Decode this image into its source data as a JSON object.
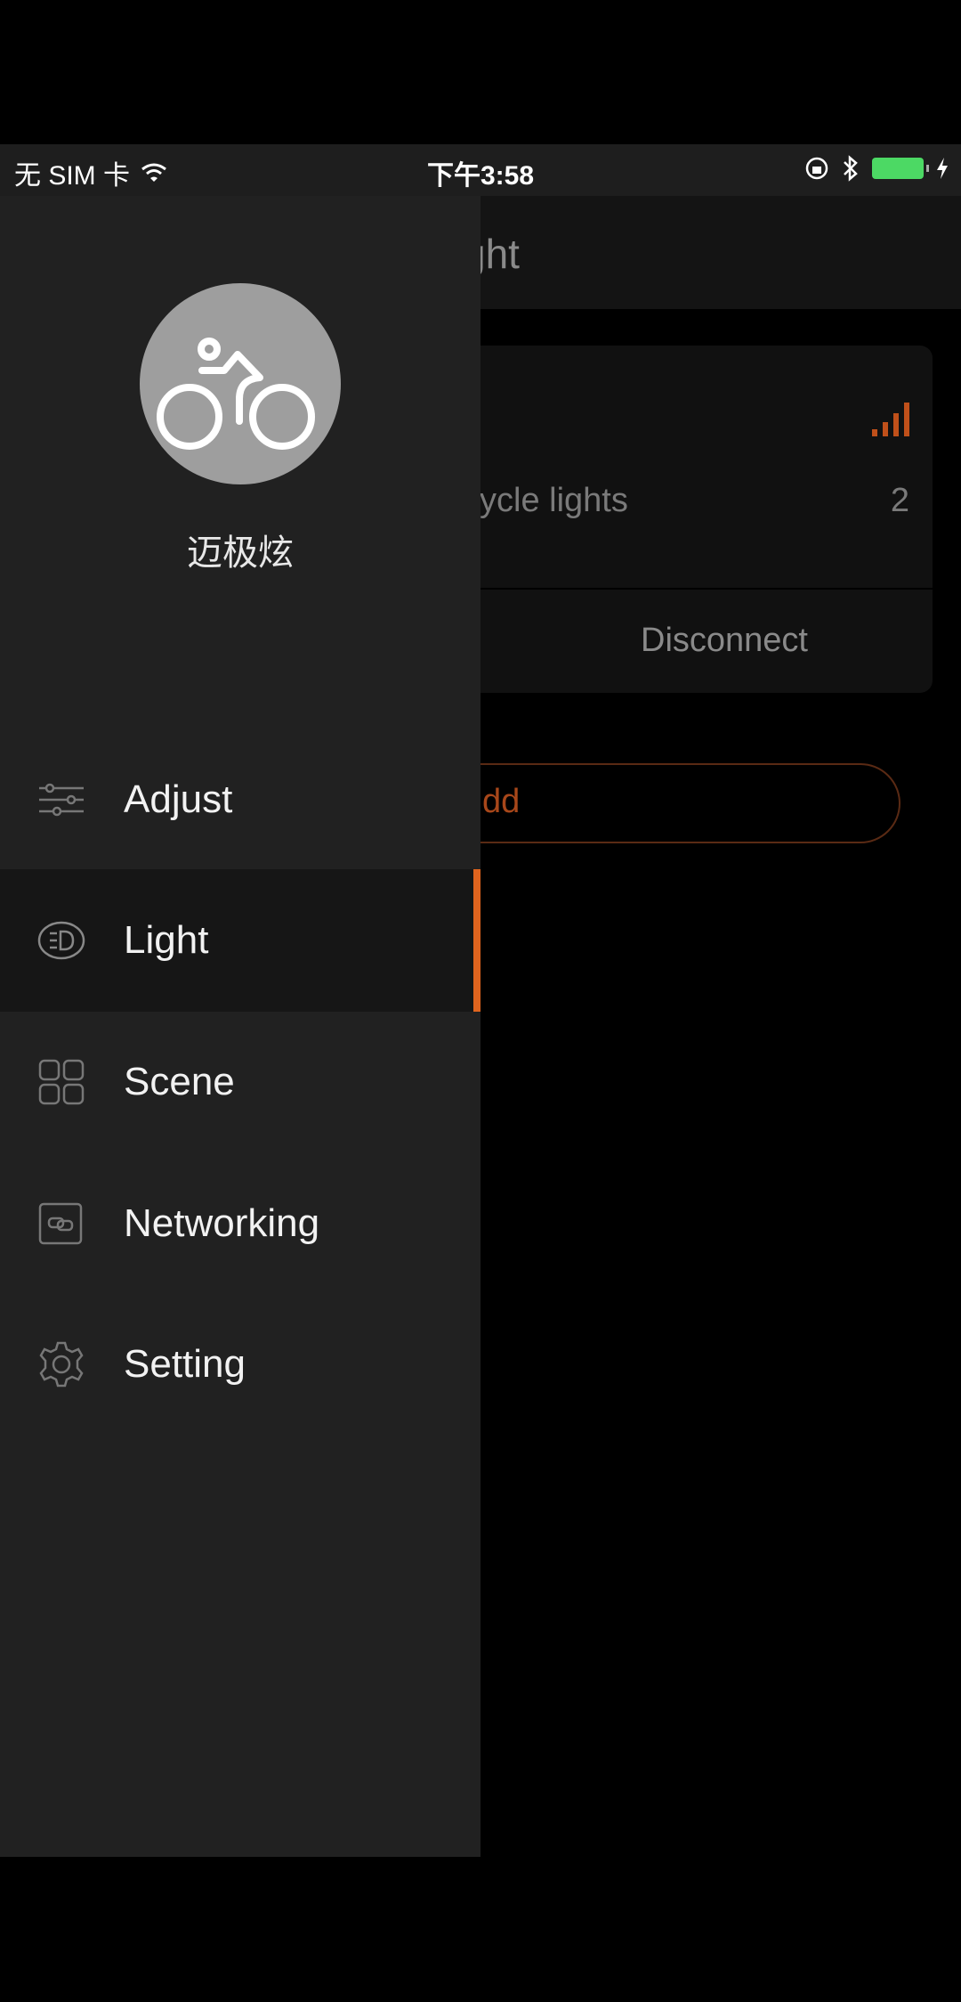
{
  "status_bar": {
    "carrier": "无 SIM 卡",
    "time": "下午3:58",
    "battery_color": "#4cd964"
  },
  "main": {
    "title_partial": "ght",
    "card": {
      "lights_label_partial": "cycle lights",
      "lights_count": "2",
      "disconnect_label": "Disconnect"
    },
    "add_button_partial": "dd",
    "accent_color": "#e0641e"
  },
  "drawer": {
    "user_name": "迈极炫",
    "avatar_icon": "cyclist-icon",
    "items": [
      {
        "label": "Adjust",
        "icon": "sliders-icon",
        "active": false
      },
      {
        "label": "Light",
        "icon": "led-icon",
        "active": true
      },
      {
        "label": "Scene",
        "icon": "grid-icon",
        "active": false
      },
      {
        "label": "Networking",
        "icon": "network-icon",
        "active": false
      },
      {
        "label": "Setting",
        "icon": "gear-icon",
        "active": false
      }
    ]
  }
}
